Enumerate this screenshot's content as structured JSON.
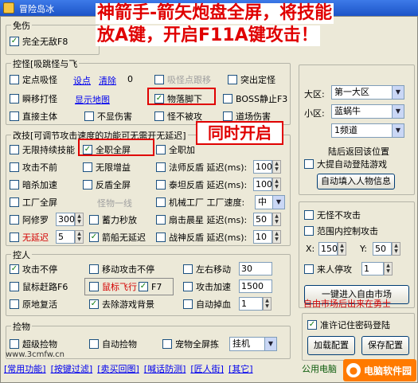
{
  "window": {
    "title": "冒险岛冰"
  },
  "banner": {
    "line1": "神箭手-箭矢炮盘全屏，将技能",
    "line2": "放A键，开启F11A键攻击！",
    "callout": "同时开启"
  },
  "grp_mianshang": {
    "label": "免伤",
    "no_invincible": "完全无敌F8",
    "invincible_key": "F8"
  },
  "grp_kongguai": {
    "label": "控怪[吸跳怪与飞",
    "fixed_suck": "定点吸怪",
    "set_point": "设点",
    "clear": "清除",
    "count": "0",
    "suck_move": "吸怪点跟移",
    "walk_to_point": "突出定怪",
    "flash_hit": "瞬移打怪",
    "show_map": "显示地图",
    "item_drop": "物落脚下",
    "boss_stop": "BOSS静止F3",
    "direct_host": "直接主体",
    "no_injury": "不显伤害",
    "no_hurt": "怪不被攻",
    "road_hurt": "道场伤害"
  },
  "grp_gaixiao": {
    "label": "改技[可调节攻击速度的功能可无需开无延迟]",
    "inf_skill": "无限持续技能",
    "full_screen": "全职全屏",
    "full_add": "全职加",
    "atk_no_front": "攻击不前",
    "inf_buff": "无限增益",
    "mage_shield_delay": "法师反盾 延迟(ms):",
    "mage_shield_val": "100",
    "dark_accel": "暗杀加速",
    "reverse_shield": "反盾全屏",
    "thief_shield_delay": "泰坦反盾 延迟(ms):",
    "thief_shield_val": "100",
    "factory_full": "工厂全屏",
    "monster_line": "怪物一线",
    "mech_factory_speed": "机械工厂 工厂速度:",
    "mech_speed_val": "中",
    "ashura": "阿修罗",
    "ashura_val": "300",
    "charge_release": "蓄力秒放",
    "fan_morning_delay": "扇击晨星 延迟(ms):",
    "fan_morning_val": "50",
    "no_delay": "无延迟",
    "no_delay_val": "5",
    "arrow_no_delay": "箭船无延迟",
    "battle_shield_delay": "战神反盾 延迟(ms):",
    "battle_shield_val": "10"
  },
  "grp_kongren": {
    "label": "控人",
    "atk_nonstop": "攻击不停",
    "move_atk_nonstop": "移动攻击不停",
    "lr_move": "左右移动",
    "lr_move_val": "30",
    "mouse_run": "鼠标赶路F6",
    "mouse_fly": "鼠标飞行",
    "f7": "F7",
    "atk_speedup": "攻击加速",
    "atk_speed_val": "1500",
    "revive": "原地复活",
    "remove_bg": "去除游戏背景",
    "auto_drop_blood": "自动掉血",
    "auto_drop_val": "1"
  },
  "grp_jianwu": {
    "label": "捡物",
    "super_pick": "超级捡物",
    "auto_pick": "自动捡物",
    "pet_full": "宠物全屏拣",
    "pet_mode": "挂机"
  },
  "right": {
    "region_label": "大区:",
    "region_val": "第一大区",
    "subregion_label": "小区:",
    "subregion_val": "蓝蜗牛",
    "channel_val": "1频道",
    "after_back": "陆后返回该位置",
    "big_ok_login": "大提自动登陆游戏",
    "auto_fill": "自动填入人物信息",
    "no_stop_attack": "无怪不攻击",
    "range_ctrl": "范围内控制攻击",
    "x_label": "X:",
    "x_val": "150",
    "y_label": "Y:",
    "y_val": "50",
    "someone_stop": "来人停攻",
    "someone_val": "1",
    "enter_market": "一键进入自由市场",
    "market_note": "自由市场后出来在勇士",
    "remember_pwd": "准许记住密码登陆",
    "load_cfg": "加载配置",
    "save_cfg": "保存配置",
    "common_bottom": "公用电脑"
  },
  "bottom_tabs": [
    "[常用功能]",
    "[按键过滤]",
    "[卖买回图]",
    "[喊话防测]",
    "[匠人街]",
    "[其它]"
  ],
  "watermark": {
    "site": "www.3cmfw.cn",
    "brand": "电脑软件园"
  }
}
